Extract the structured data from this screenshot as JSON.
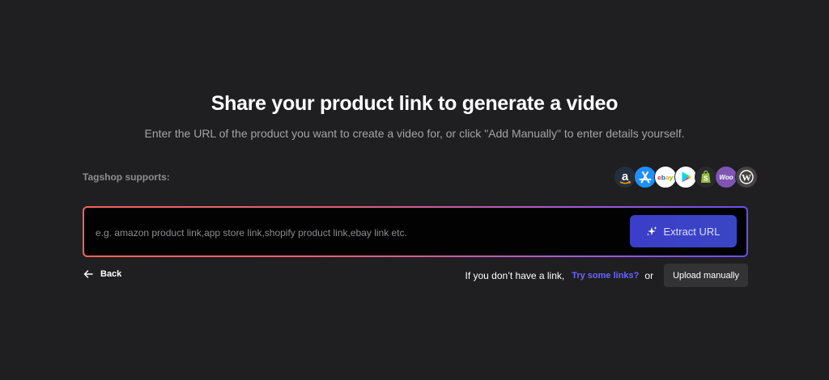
{
  "header": {
    "title": "Share your product link to generate a video",
    "subtitle": "Enter the URL of the product you want to create a video for, or click \"Add Manually\" to enter details yourself."
  },
  "supports": {
    "label": "Tagshop supports:",
    "platforms": [
      {
        "name": "Amazon",
        "icon": "amazon-icon",
        "color": "#232f3e"
      },
      {
        "name": "App Store",
        "icon": "app-store-icon",
        "color": "#1e90ff"
      },
      {
        "name": "eBay",
        "icon": "ebay-icon",
        "color": "#ffffff"
      },
      {
        "name": "Google Play",
        "icon": "google-play-icon",
        "color": "#ffffff"
      },
      {
        "name": "Shopify",
        "icon": "shopify-icon",
        "color": "#95bf47"
      },
      {
        "name": "WooCommerce",
        "icon": "woocommerce-icon",
        "color": "#7f54b3"
      },
      {
        "name": "WordPress",
        "icon": "wordpress-icon",
        "color": "#464342"
      }
    ]
  },
  "input": {
    "placeholder": "e.g. amazon product link,app store link,shopify product link,ebay link etc.",
    "value": "",
    "extract_label": "Extract URL",
    "extract_icon": "sparkle-icon"
  },
  "footer": {
    "back_label": "Back",
    "no_link_text": "If you don’t have a link,",
    "try_links_label": "Try some links?",
    "or_text": "or",
    "upload_label": "Upload manually"
  },
  "colors": {
    "background": "#1f1f21",
    "accent": "#6b62ff",
    "button": "#3a44c6",
    "border_gradient_start": "#f0645a",
    "border_gradient_end": "#6a4fe8"
  }
}
